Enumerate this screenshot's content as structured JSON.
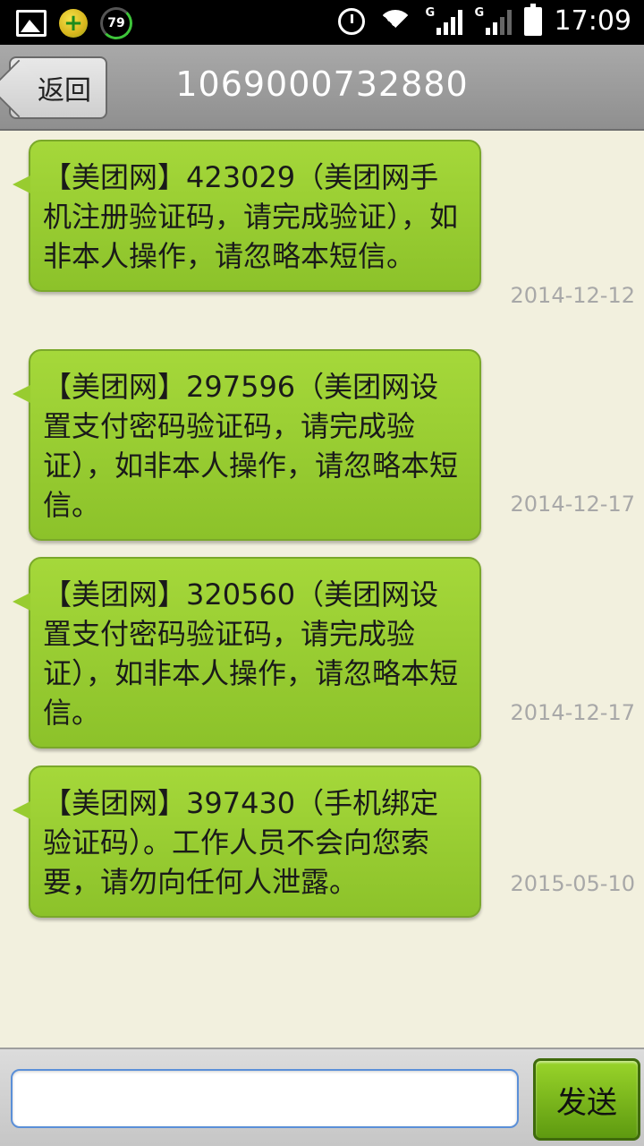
{
  "status_bar": {
    "battery_badge": "79",
    "network_type_1": "G",
    "network_type_2": "G",
    "time": "17:09"
  },
  "header": {
    "back_label": "返回",
    "title": "1069000732880"
  },
  "messages": [
    {
      "text": "【美团网】423029（美团网手机注册验证码，请完成验证），如非本人操作，请忽略本短信。",
      "date": "2014-12-12"
    },
    {
      "text": "【美团网】297596（美团网设置支付密码验证码，请完成验证），如非本人操作，请忽略本短信。",
      "date": "2014-12-17"
    },
    {
      "text": "【美团网】320560（美团网设置支付密码验证码，请完成验证），如非本人操作，请忽略本短信。",
      "date": "2014-12-17"
    },
    {
      "text": "【美团网】397430（手机绑定验证码）。工作人员不会向您索要，请勿向任何人泄露。",
      "date": "2015-05-10"
    }
  ],
  "composer": {
    "input_value": "",
    "send_label": "发送"
  }
}
